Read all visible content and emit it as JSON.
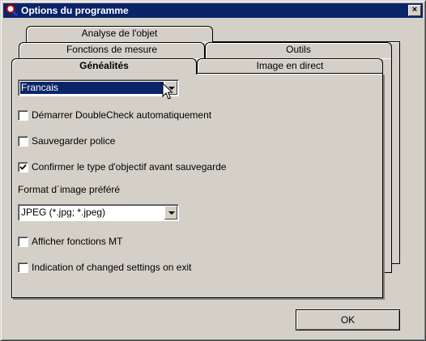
{
  "window": {
    "title": "Options du programme",
    "close_symbol": "×"
  },
  "tabs": [
    {
      "label": "Analyse de l'objet"
    },
    {
      "label": "Fonctions de mesure"
    },
    {
      "label": "Outils"
    },
    {
      "label": "Généalités",
      "active": true
    },
    {
      "label": "Image en direct"
    }
  ],
  "general": {
    "language_select": {
      "value": "Francais"
    },
    "options": [
      {
        "label": "Démarrer DoubleCheck automatiquement",
        "checked": false
      },
      {
        "label": "Sauvegarder police",
        "checked": false
      },
      {
        "label": "Confirmer le type d'objectif avant sauvegarde",
        "checked": true
      }
    ],
    "image_format_label": "Format d´image préféré",
    "image_format_select": {
      "value": "JPEG (*.jpg; *.jpeg)"
    },
    "extra_options": [
      {
        "label": "Afficher fonctions MT",
        "checked": false
      },
      {
        "label": "Indication of changed settings on exit",
        "checked": false
      }
    ]
  },
  "buttons": {
    "ok": "OK"
  },
  "colors": {
    "titlebar": "#0a246a",
    "face": "#d4d0c8",
    "selection": "#0a246a"
  }
}
